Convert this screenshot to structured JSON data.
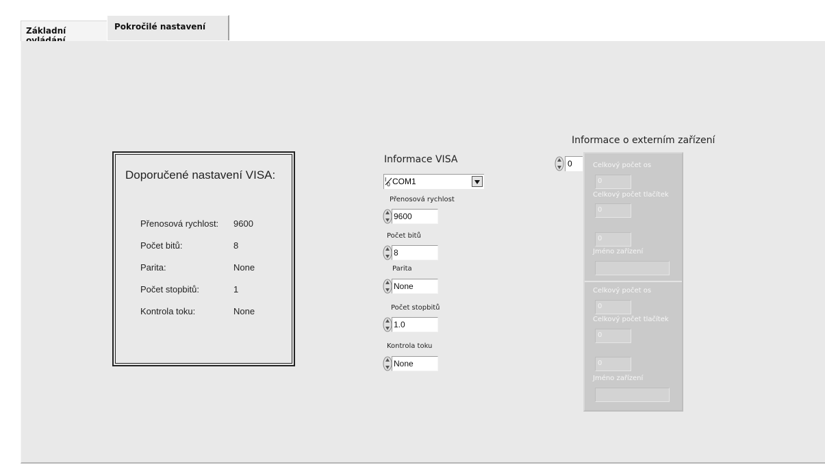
{
  "tabs": [
    {
      "label": "Základní ovládání"
    },
    {
      "label": "Pokročilé nastavení"
    }
  ],
  "recommended": {
    "title": "Doporučené nastavení VISA:",
    "rows": [
      {
        "label": "Přenosová rychlost:",
        "value": "9600"
      },
      {
        "label": "Počet bitů:",
        "value": "8"
      },
      {
        "label": "Parita:",
        "value": "None"
      },
      {
        "label": "Počet stopbitů:",
        "value": "1"
      },
      {
        "label": "Kontrola toku:",
        "value": "None"
      }
    ]
  },
  "visa": {
    "title": "Informace VISA",
    "resource": "COM1",
    "baud_label": "Přenosová rychlost",
    "baud_value": "9600",
    "bits_label": "Počet bitů",
    "bits_value": "8",
    "parity_label": "Parita",
    "parity_value": "None",
    "stopbits_label": "Počet stopbitů",
    "stopbits_value": "1.0",
    "flow_label": "Kontrola toku",
    "flow_value": "None"
  },
  "external": {
    "title": "Informace o externím zařízení",
    "index_value": "0",
    "devices": [
      {
        "axes_label": "Celkový počet os",
        "axes_value": "0",
        "buttons_label": "Celkový počet tlačítek",
        "buttons_value": "0",
        "extra_value": "0",
        "name_label": "Jméno zařízení",
        "name_value": ""
      },
      {
        "axes_label": "Celkový počet os",
        "axes_value": "0",
        "buttons_label": "Celkový počet tlačítek",
        "buttons_value": "0",
        "extra_value": "0",
        "name_label": "Jméno zařízení",
        "name_value": ""
      }
    ]
  },
  "colors": {
    "panel_bg": "#e9e9e9",
    "cluster_bg": "#cacaca"
  },
  "icons": {
    "stepper": "up-down-arrows-icon",
    "combo": "visa-resource-icon",
    "dropdown": "triangle-down-icon"
  }
}
